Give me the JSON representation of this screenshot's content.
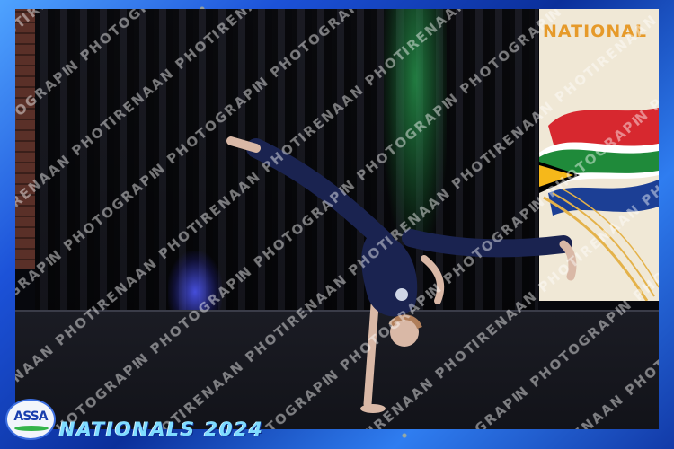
{
  "frame": {
    "accent": "#1c52d8",
    "glitter": "#ffd75a"
  },
  "banner": {
    "title": "NATIONAL",
    "title_color": "#e69a2a"
  },
  "watermark": {
    "text": "IRENAAN PHOTOGRAPHY"
  },
  "logo": {
    "text": "ASSA"
  },
  "event": {
    "title": "NATIONALS 2024"
  },
  "scene": {
    "subject": "gymnast-one-handed-split-handstand",
    "leotard_color": "#1a2350",
    "stage_lights": [
      "#2aa050",
      "#5060ff"
    ]
  }
}
